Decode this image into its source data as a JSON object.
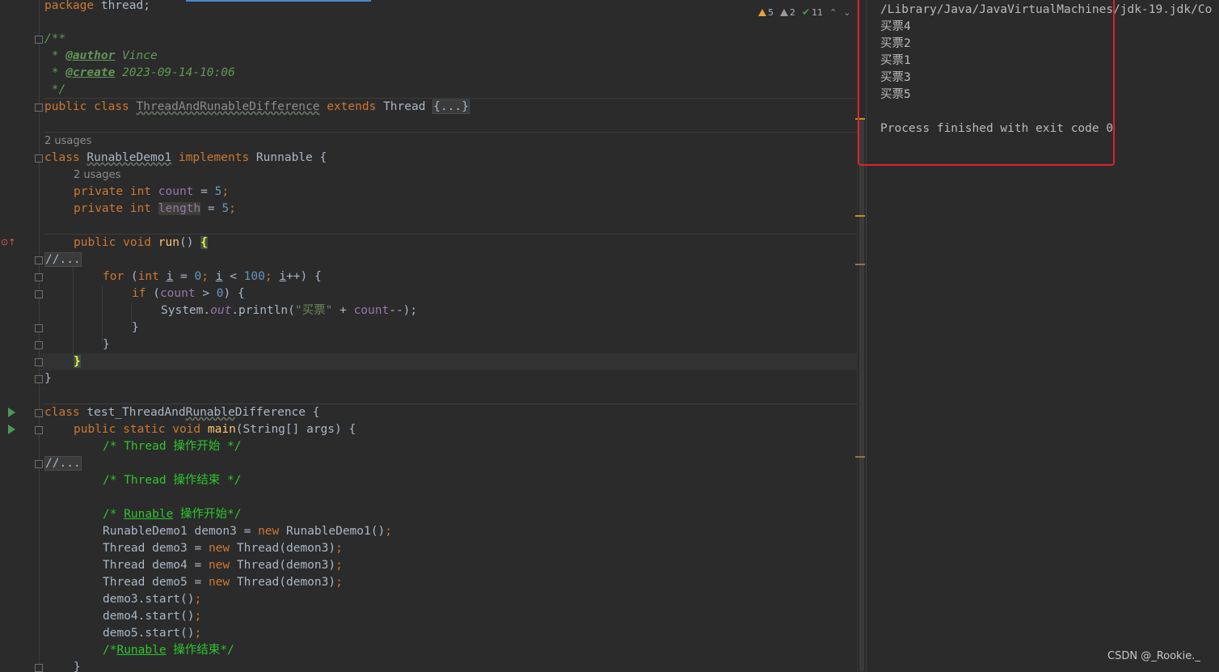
{
  "editor": {
    "inspections": {
      "warnings": "5",
      "weak_warnings": "2",
      "ok": "11"
    },
    "hints": {
      "usages_class": "2 usages",
      "usages_field": "2 usages"
    },
    "lines": {
      "l01_kw": "package",
      "l01_rest": " thread;",
      "l03": "/**",
      "l04_star": " * ",
      "l04_tag": "@author",
      "l04_val": " Vince",
      "l05_star": " * ",
      "l05_tag": "@create",
      "l05_val": " 2023-09-14-10:06",
      "l06": " */",
      "l07_kw": "public class ",
      "l07_name": "ThreadAndRunableDifference",
      "l07_ext": " extends ",
      "l07_type": "Thread ",
      "l07_fold": "{...}",
      "l09_kw": "class ",
      "l09_name": "RunableDemo1",
      "l09_impl": " implements ",
      "l09_rest": "Runnable {",
      "l11_kw": "private int ",
      "l11_fld": "count",
      "l11_eq": " = ",
      "l11_num": "5",
      "l11_semi": ";",
      "l12_kw": "private int ",
      "l12_fld": "length",
      "l12_eq": " = ",
      "l12_num": "5",
      "l12_semi": ";",
      "l14_kw": "public void ",
      "l14_fn": "run",
      "l14_paren": "() ",
      "l14_brace": "{",
      "l15_fold": "//...",
      "l16_kw": "for",
      "l16_a": " (",
      "l16_int": "int ",
      "l16_i": "i",
      "l16_eq": " = ",
      "l16_zero": "0",
      "l16_s1": "; ",
      "l16_i2": "i",
      "l16_lt": " < ",
      "l16_hun": "100",
      "l16_s2": "; ",
      "l16_i3": "i",
      "l16_end": "++) {",
      "l17_kw": "if",
      "l17_a": " (",
      "l17_fld": "count",
      "l17_gt": " > ",
      "l17_zero": "0",
      "l17_end": ") {",
      "l18_sys": "System.",
      "l18_out": "out",
      "l18_pl": ".println(",
      "l18_str": "\"买票\"",
      "l18_plus": " + ",
      "l18_fld": "count",
      "l18_end": "--);",
      "l19": "}",
      "l20": "}",
      "l21_brace": "}",
      "l22": "}",
      "l24_kw": "class ",
      "l24_pre": "test_ThreadAnd",
      "l24_name": "Runable",
      "l24_post": "Difference {",
      "l25_kw": "public static void ",
      "l25_fn": "main",
      "l25_rest": "(String[] args) {",
      "l26_com": "/* Thread ",
      "l26_blk": "操作开始",
      "l26_end": " */",
      "l27_fold": "//...",
      "l28_com": "/* Thread ",
      "l28_blk": "操作结束",
      "l28_end": " */",
      "l30_com": "/* ",
      "l30_ul": "Runable",
      "l30_blk": " 操作开始",
      "l30_end": "*/",
      "l31_a": "RunableDemo1 demon3 = ",
      "l31_new": "new ",
      "l31_b": "RunableDemo1()",
      "l31_semi": ";",
      "l32_a": "Thread demo3 = ",
      "l32_new": "new ",
      "l32_b": "Thread(demon3)",
      "l32_semi": ";",
      "l33_a": "Thread demo4 = ",
      "l33_new": "new ",
      "l33_b": "Thread(demon3)",
      "l33_semi": ";",
      "l34_a": "Thread demo5 = ",
      "l34_new": "new ",
      "l34_b": "Thread(demon3)",
      "l34_semi": ";",
      "l35_a": "demo3.start()",
      "l35_semi": ";",
      "l36_a": "demo4.start()",
      "l36_semi": ";",
      "l37_a": "demo5.start()",
      "l37_semi": ";",
      "l38_com": "/*",
      "l38_ul": "Runable",
      "l38_blk": " 操作结束",
      "l38_end": "*/",
      "l39": "}"
    }
  },
  "console": {
    "path": "/Library/Java/JavaVirtualMachines/jdk-19.jdk/Co",
    "outputs": [
      "买票4",
      "买票2",
      "买票1",
      "买票3",
      "买票5"
    ],
    "exit": "Process finished with exit code 0"
  },
  "watermark": "CSDN @_Rookie._",
  "colors": {
    "keyword": "#cc7832",
    "comment": "#629755",
    "string": "#6a8759",
    "field": "#9876aa",
    "number": "#6897bb",
    "highlight_box": "#e0202c"
  }
}
